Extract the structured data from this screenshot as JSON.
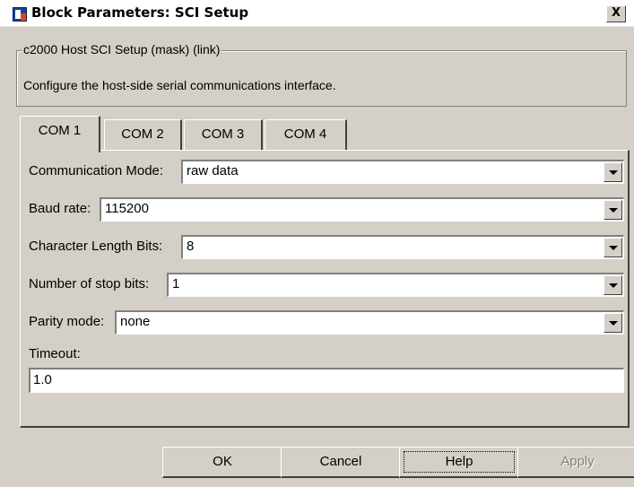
{
  "window": {
    "title": "Block Parameters: SCI Setup",
    "close_label": "X"
  },
  "description_group": {
    "legend": "c2000 Host SCI Setup (mask) (link)",
    "text": "Configure the host-side serial communications interface."
  },
  "tabs": [
    {
      "label": "COM 1",
      "active": true
    },
    {
      "label": "COM 2",
      "active": false
    },
    {
      "label": "COM 3",
      "active": false
    },
    {
      "label": "COM 4",
      "active": false
    }
  ],
  "fields": {
    "communication_mode": {
      "label": "Communication Mode:",
      "value": "raw data"
    },
    "baud_rate": {
      "label": "Baud rate:",
      "value": "115200"
    },
    "character_length_bits": {
      "label": "Character Length Bits:",
      "value": "8"
    },
    "stop_bits": {
      "label": "Number of stop bits:",
      "value": "1"
    },
    "parity_mode": {
      "label": "Parity mode:",
      "value": "none"
    },
    "timeout": {
      "label": "Timeout:",
      "value": "1.0"
    }
  },
  "buttons": {
    "ok": "OK",
    "cancel": "Cancel",
    "help": "Help",
    "apply": "Apply"
  },
  "icons": {
    "title": "simulink-block-icon",
    "dropdown": "chevron-down-icon"
  }
}
